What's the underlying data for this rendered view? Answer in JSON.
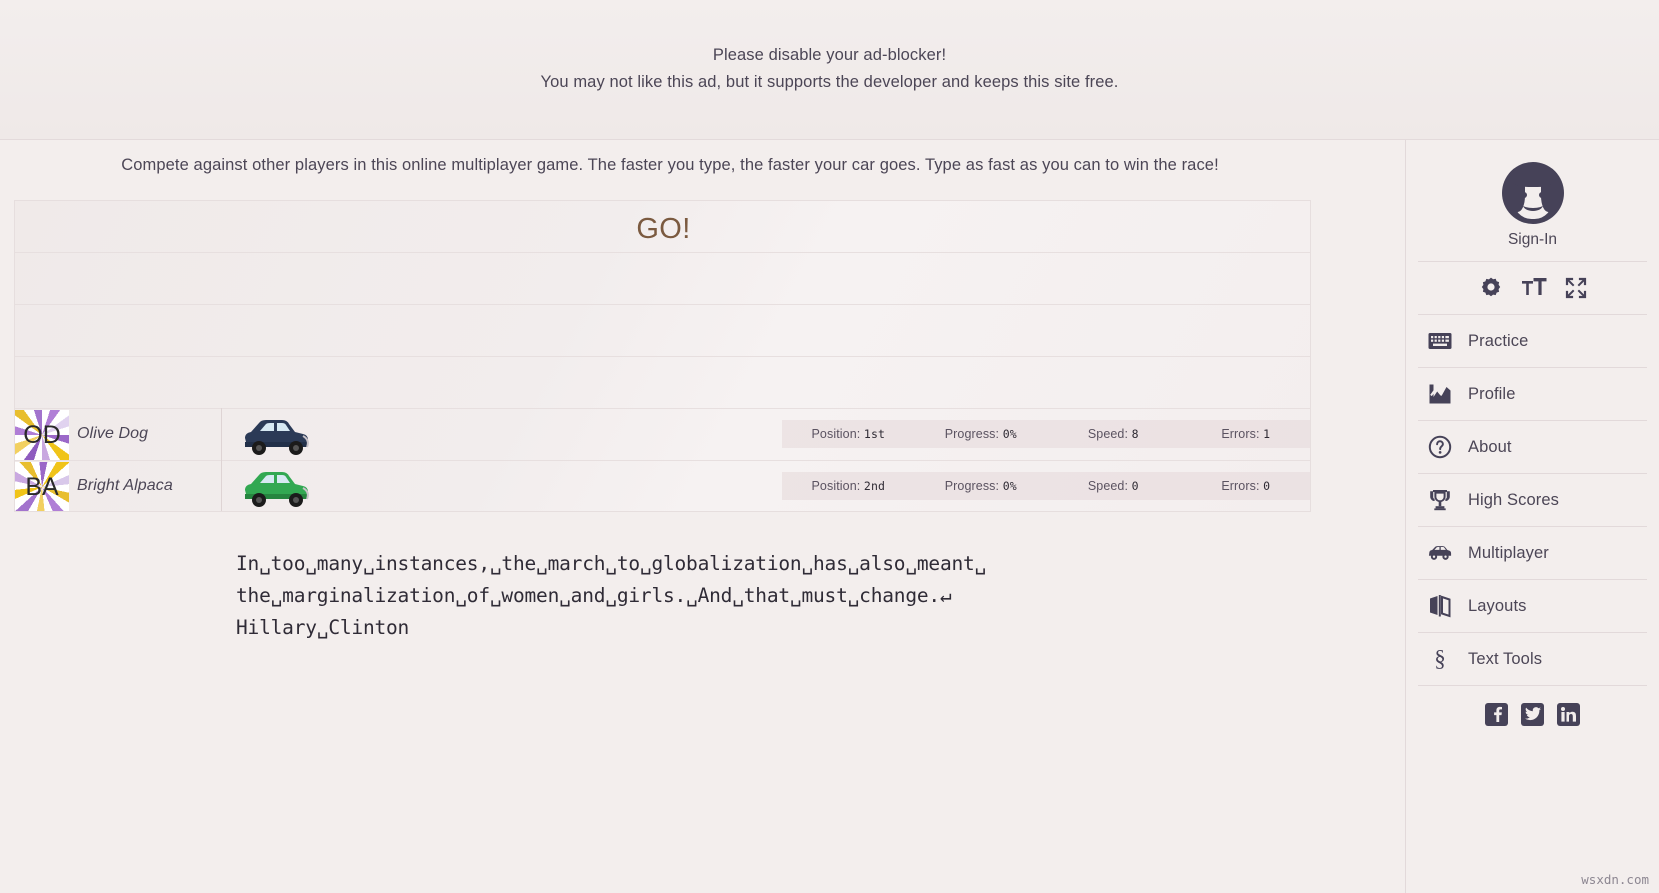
{
  "ad": {
    "line1": "Please disable your ad-blocker!",
    "line2": "You may not like this ad, but it supports the developer and keeps this site free."
  },
  "main": {
    "intro": "Compete against other players in this online multiplayer game. The faster you type, the faster your car goes. Type as fast as you can to win the race!",
    "go_text": "GO!",
    "typing_text": "In␣too␣many␣instances,␣the␣march␣to␣globalization␣has␣also␣meant␣\nthe␣marginalization␣of␣women␣and␣girls.␣And␣that␣must␣change.↵\nHillary␣Clinton"
  },
  "stat_labels": {
    "position": "Position:",
    "progress": "Progress:",
    "speed": "Speed:",
    "errors": "Errors:"
  },
  "players": [
    {
      "initials": "OD",
      "name": "Olive Dog",
      "car_color": "#2b3a56",
      "position": "1st",
      "progress": "0%",
      "speed": "8",
      "errors": "1"
    },
    {
      "initials": "BA",
      "name": "Bright Alpaca",
      "car_color": "#32a852",
      "position": "2nd",
      "progress": "0%",
      "speed": "0",
      "errors": "0"
    }
  ],
  "sidebar": {
    "signin_label": "Sign-In",
    "quick_icons": [
      {
        "name": "gear-icon"
      },
      {
        "name": "font-size-icon"
      },
      {
        "name": "fullscreen-icon"
      }
    ],
    "items": [
      {
        "label": "Practice",
        "icon": "keyboard-icon"
      },
      {
        "label": "Profile",
        "icon": "chart-icon"
      },
      {
        "label": "About",
        "icon": "question-circle-icon"
      },
      {
        "label": "High Scores",
        "icon": "trophy-icon"
      },
      {
        "label": "Multiplayer",
        "icon": "car-icon"
      },
      {
        "label": "Layouts",
        "icon": "layouts-icon"
      },
      {
        "label": "Text Tools",
        "icon": "section-sign-icon"
      }
    ],
    "social": [
      {
        "name": "facebook-icon",
        "glyph": "f"
      },
      {
        "name": "twitter-icon",
        "glyph": "ᴠ"
      },
      {
        "name": "linkedin-icon",
        "glyph": "in"
      }
    ]
  },
  "watermark": "wsxdn.com",
  "colors": {
    "background": "#f3eeed",
    "text": "#4c4656",
    "go": "#7b5a40",
    "accent": "#464258"
  }
}
